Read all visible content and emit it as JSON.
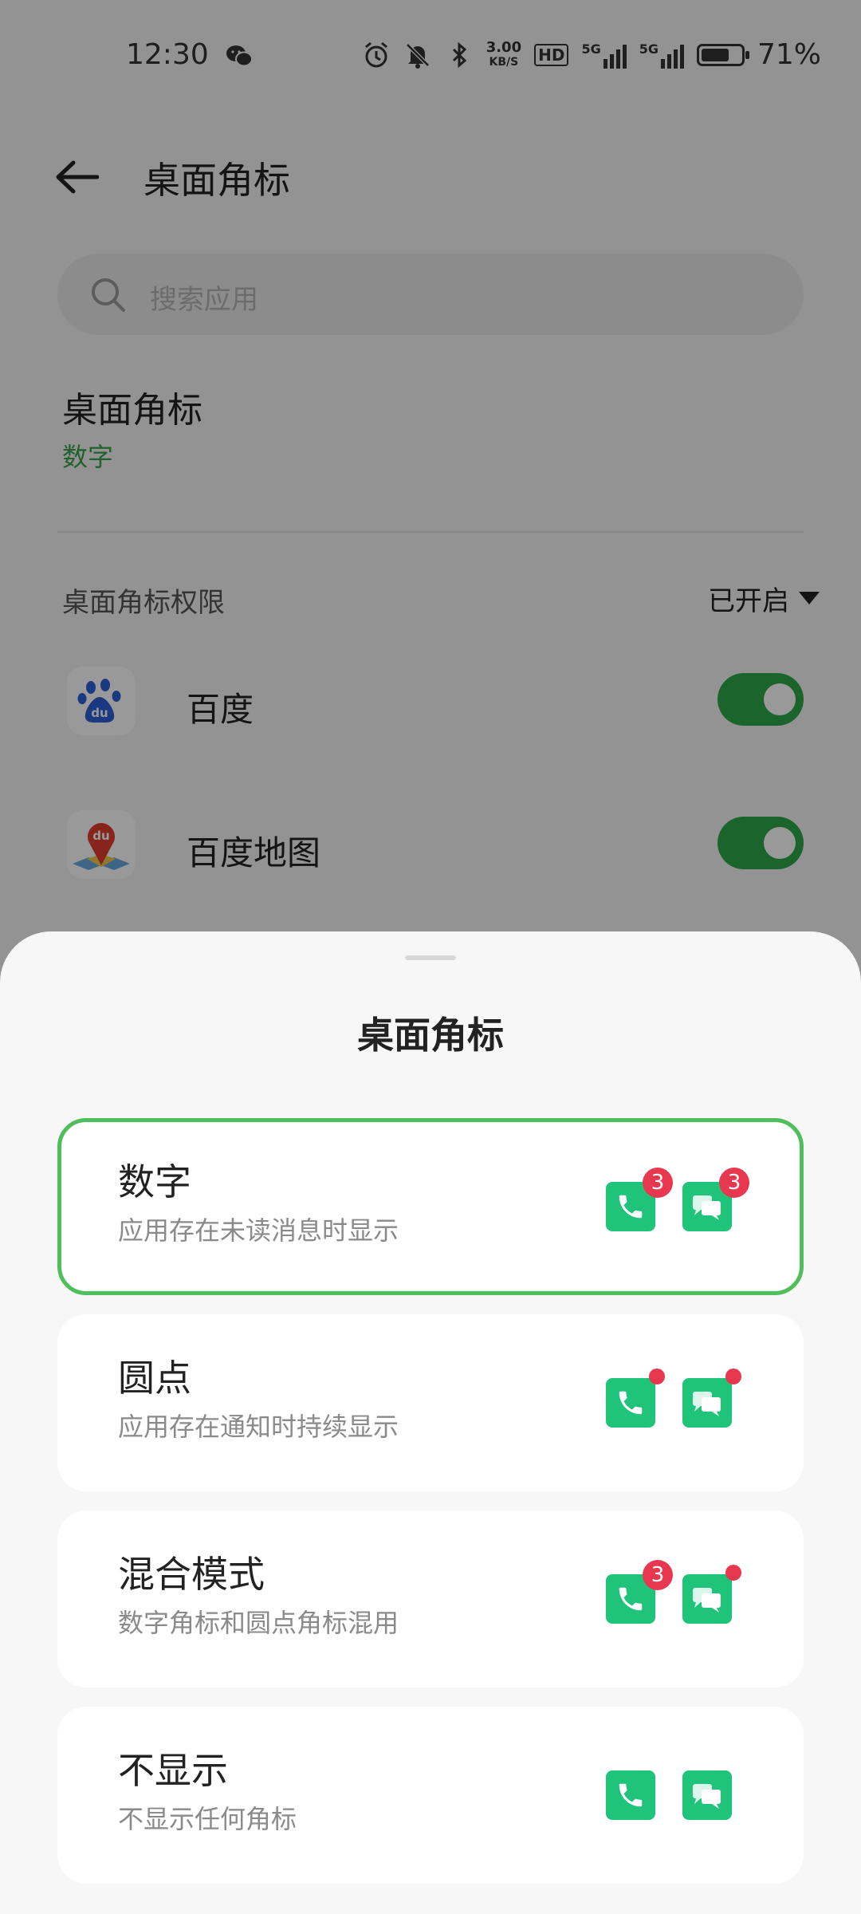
{
  "status_bar": {
    "time": "12:30",
    "speed_value": "3.00",
    "speed_unit": "KB/S",
    "hd_label": "HD",
    "net1": "5G",
    "net2": "5G",
    "battery_percent": "71%",
    "battery_level": 0.71,
    "icons": [
      "wechat-icon",
      "alarm-icon",
      "mute-bell-icon",
      "bluetooth-icon",
      "signal-icon",
      "signal-icon",
      "battery-icon"
    ]
  },
  "header": {
    "title": "桌面角标",
    "back_icon": "arrow-left-icon"
  },
  "search": {
    "placeholder": "搜索应用",
    "icon": "search-icon"
  },
  "badge_setting": {
    "title": "桌面角标",
    "value": "数字"
  },
  "permissions": {
    "label": "桌面角标权限",
    "filter": "已开启",
    "apps": [
      {
        "name": "百度",
        "enabled": true
      },
      {
        "name": "百度地图",
        "enabled": true
      }
    ]
  },
  "sheet": {
    "title": "桌面角标",
    "options": [
      {
        "title": "数字",
        "subtitle": "应用存在未读消息时显示",
        "selected": true,
        "phone_badge": "3",
        "msg_badge": "3"
      },
      {
        "title": "圆点",
        "subtitle": "应用存在通知时持续显示",
        "selected": false
      },
      {
        "title": "混合模式",
        "subtitle": "数字角标和圆点角标混用",
        "selected": false,
        "phone_badge": "3"
      },
      {
        "title": "不显示",
        "subtitle": "不显示任何角标",
        "selected": false
      }
    ]
  },
  "colors": {
    "accent": "#2ea84b",
    "icon_green": "#1fc47a",
    "badge_red": "#e8384f",
    "selected_border": "#4fbe5c"
  }
}
